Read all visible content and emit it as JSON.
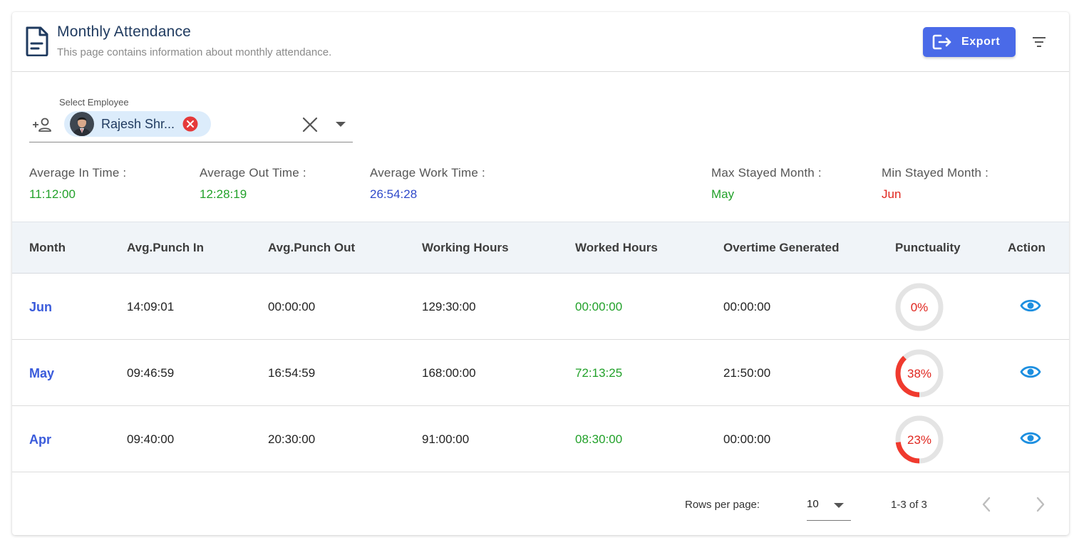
{
  "header": {
    "title": "Monthly Attendance",
    "subtitle": "This page contains information about monthly attendance.",
    "export_label": "Export",
    "accent_color": "#4a6ae8"
  },
  "employee_select": {
    "label": "Select Employee",
    "selected_name": "Rajesh Shr..."
  },
  "stats": [
    {
      "label": "Average In Time :",
      "value": "11:12:00",
      "color": "#22a12a"
    },
    {
      "label": "Average Out Time :",
      "value": "12:28:19",
      "color": "#22a12a"
    },
    {
      "label": "Average Work Time :",
      "value": "26:54:28",
      "color": "#2f49c9"
    },
    {
      "label": "Max Stayed Month :",
      "value": "May",
      "color": "#22a12a"
    },
    {
      "label": "Min Stayed Month :",
      "value": "Jun",
      "color": "#e0261f"
    }
  ],
  "table": {
    "columns": [
      "Month",
      "Avg.Punch In",
      "Avg.Punch Out",
      "Working Hours",
      "Worked Hours",
      "Overtime Generated",
      "Punctuality",
      "Action"
    ],
    "rows": [
      {
        "month": "Jun",
        "punch_in": "14:09:01",
        "punch_out": "00:00:00",
        "working_hours": "129:30:00",
        "worked_hours": "00:00:00",
        "overtime": "00:00:00",
        "punctuality": "0%",
        "punctuality_value": 0
      },
      {
        "month": "May",
        "punch_in": "09:46:59",
        "punch_out": "16:54:59",
        "working_hours": "168:00:00",
        "worked_hours": "72:13:25",
        "overtime": "21:50:00",
        "punctuality": "38%",
        "punctuality_value": 38
      },
      {
        "month": "Apr",
        "punch_in": "09:40:00",
        "punch_out": "20:30:00",
        "working_hours": "91:00:00",
        "worked_hours": "08:30:00",
        "overtime": "00:00:00",
        "punctuality": "23%",
        "punctuality_value": 23
      }
    ]
  },
  "pagination": {
    "rows_per_page_label": "Rows per page:",
    "rows_per_page": "10",
    "range": "1-3 of 3"
  },
  "colors": {
    "punctuality": "#f03a2e",
    "ring_track": "#e4e4e4",
    "eye": "#1d8fe0"
  }
}
